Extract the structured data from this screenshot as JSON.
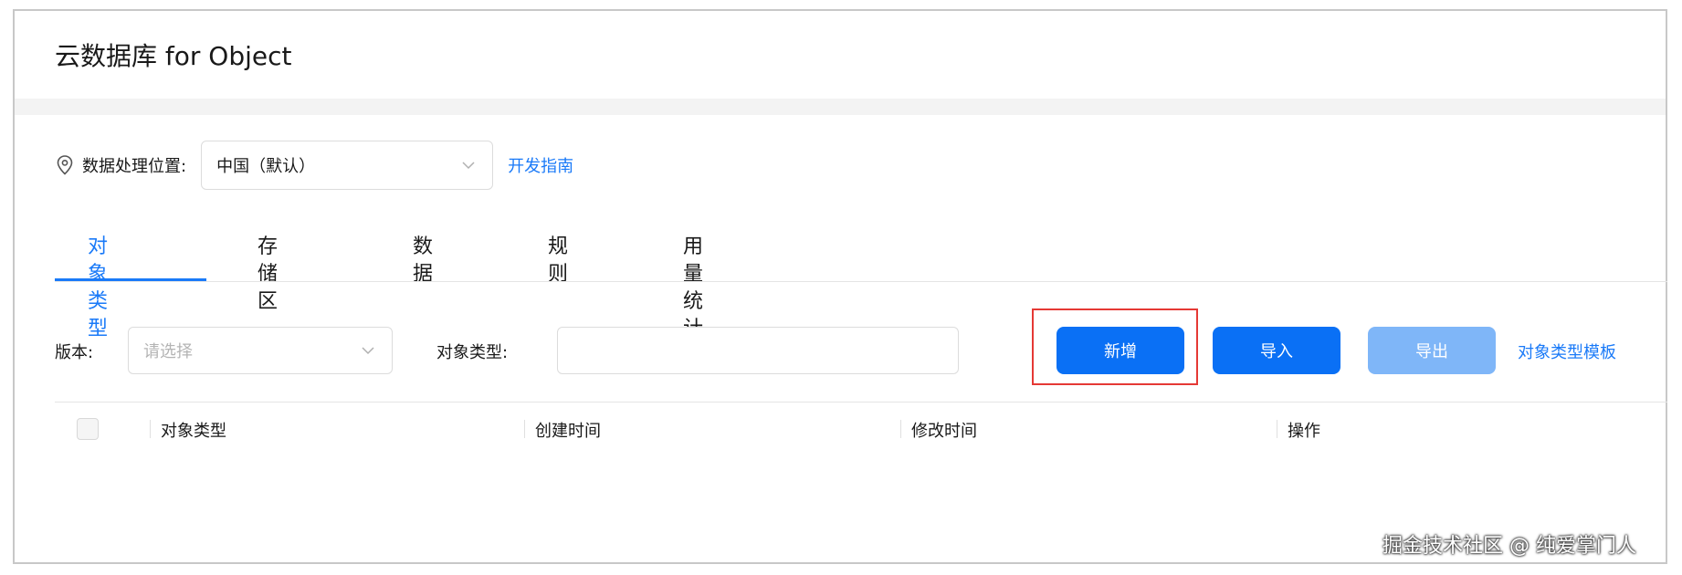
{
  "header": {
    "title": "云数据库 for Object"
  },
  "location": {
    "icon": "location-pin-icon",
    "label": "数据处理位置:",
    "selected": "中国（默认）",
    "link": "开发指南"
  },
  "tabs": [
    {
      "label": "对象类型",
      "active": true
    },
    {
      "label": "存储区",
      "active": false
    },
    {
      "label": "数据",
      "active": false
    },
    {
      "label": "规则",
      "active": false
    },
    {
      "label": "用量统计",
      "active": false
    }
  ],
  "filters": {
    "version_label": "版本:",
    "version_placeholder": "请选择",
    "object_type_label": "对象类型:",
    "object_type_value": ""
  },
  "actions": {
    "new_label": "新增",
    "import_label": "导入",
    "export_label": "导出",
    "template_link": "对象类型模板"
  },
  "table": {
    "columns": [
      "对象类型",
      "创建时间",
      "修改时间",
      "操作"
    ]
  },
  "watermark": "掘金技术社区 @ 纯爱掌门人",
  "colors": {
    "accent": "#1a7af8",
    "primary_button": "#0a70f5",
    "disabled_button": "#7fb6f8",
    "highlight": "#e53935"
  }
}
